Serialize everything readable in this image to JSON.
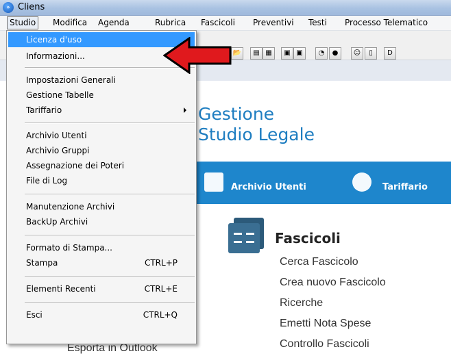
{
  "window": {
    "title": "Cliens",
    "app_icon_glyph": "»"
  },
  "menubar": {
    "items": [
      "Studio",
      "Modifica",
      "Agenda",
      "Rubrica",
      "Fascicoli",
      "Preventivi",
      "Testi",
      "Processo Telematico"
    ]
  },
  "toolbar": {
    "partial_label": "D"
  },
  "brand": {
    "title": "Gestione",
    "subtitle": "Studio Legale"
  },
  "band": {
    "item1": "Archivio Utenti",
    "item2": "Tariffario"
  },
  "section": {
    "title": "Fascicoli",
    "links": [
      "Cerca Fascicolo",
      "Crea nuovo Fascicolo",
      "Ricerche",
      "Emetti Nota Spese",
      "Controllo Fascicoli"
    ]
  },
  "obscured_text": "Esporta in Outlook",
  "dropdown": {
    "items": [
      {
        "label": "Licenza d'uso",
        "shortcut": ""
      },
      {
        "label": "Informazioni...",
        "shortcut": ""
      },
      {
        "label": "Impostazioni Generali",
        "shortcut": ""
      },
      {
        "label": "Gestione Tabelle",
        "shortcut": ""
      },
      {
        "label": "Tariffario",
        "shortcut": ""
      },
      {
        "label": "Archivio Utenti",
        "shortcut": ""
      },
      {
        "label": "Archivio Gruppi",
        "shortcut": ""
      },
      {
        "label": "Assegnazione dei Poteri",
        "shortcut": ""
      },
      {
        "label": "File di Log",
        "shortcut": ""
      },
      {
        "label": "Manutenzione Archivi",
        "shortcut": ""
      },
      {
        "label": "BackUp Archivi",
        "shortcut": ""
      },
      {
        "label": "Formato di Stampa...",
        "shortcut": ""
      },
      {
        "label": "Stampa",
        "shortcut": "CTRL+P"
      },
      {
        "label": "Elementi Recenti",
        "shortcut": "CTRL+E"
      },
      {
        "label": "Esci",
        "shortcut": "CTRL+Q"
      }
    ]
  },
  "colors": {
    "highlight": "#3399ff",
    "brand_blue": "#1f7ec1",
    "band_blue": "#1e86cc",
    "arrow_red": "#e0191d"
  }
}
